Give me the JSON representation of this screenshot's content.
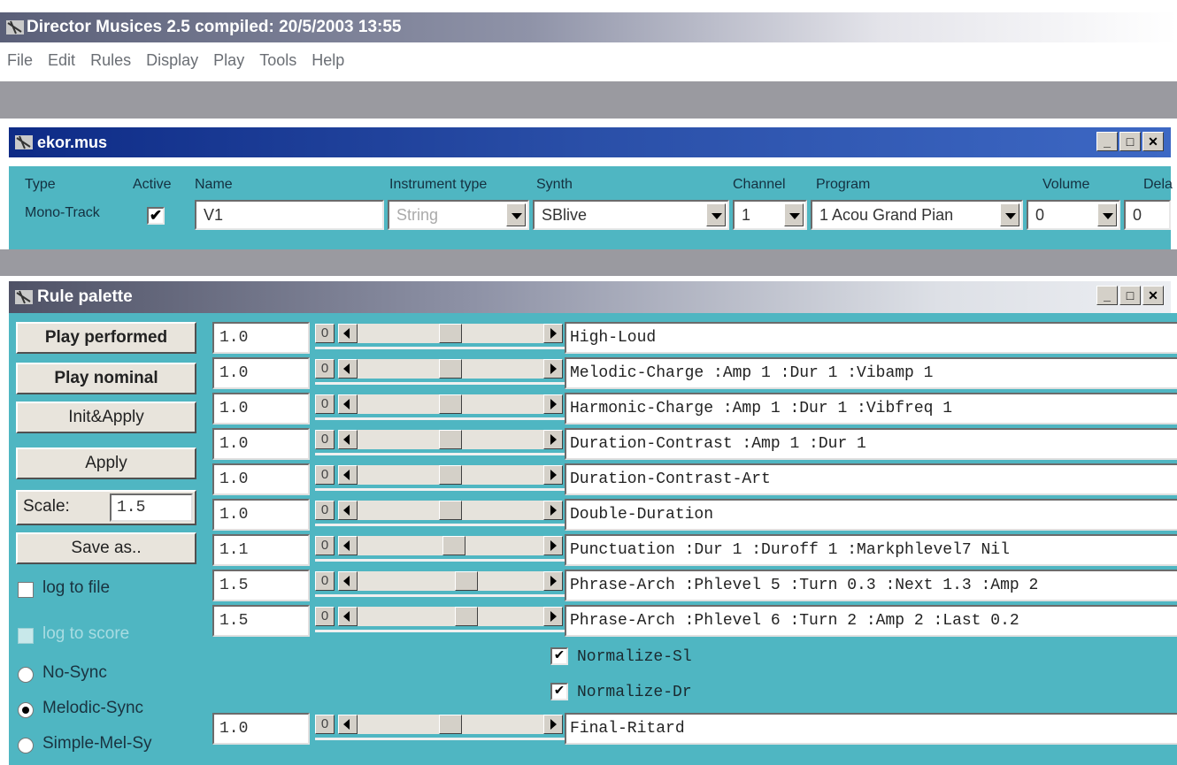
{
  "app": {
    "title": "Director Musices 2.5   compiled: 20/5/2003 13:55",
    "menu": [
      "File",
      "Edit",
      "Rules",
      "Display",
      "Play",
      "Tools",
      "Help"
    ]
  },
  "track_window": {
    "title": "ekor.mus",
    "headers": {
      "type": "Type",
      "active": "Active",
      "name": "Name",
      "instrument_type": "Instrument type",
      "synth": "Synth",
      "channel": "Channel",
      "program": "Program",
      "volume": "Volume",
      "delay": "Dela"
    },
    "row": {
      "type": "Mono-Track",
      "active_mark": "✔",
      "name": "V1",
      "instrument_type": "String",
      "synth": "SBlive",
      "channel": "1",
      "program": "1 Acou Grand Pian",
      "volume": "0",
      "delay": "0"
    }
  },
  "palette": {
    "title": "Rule palette",
    "buttons": {
      "play_performed": "Play performed",
      "play_nominal": "Play nominal",
      "init_apply": "Init&Apply",
      "apply": "Apply",
      "scale_label": "Scale:",
      "scale_value": "1.5",
      "save_as": "Save as.."
    },
    "options": {
      "log_to_file": "log to file",
      "log_to_score": "log to score",
      "no_sync": "No-Sync",
      "melodic_sync": "Melodic-Sync",
      "simple_mel_sync": "Simple-Mel-Sy"
    },
    "rules": [
      {
        "value": "1.0",
        "zero": "0",
        "slider": 0.5,
        "name": "High-Loud"
      },
      {
        "value": "1.0",
        "zero": "0",
        "slider": 0.5,
        "name": "Melodic-Charge :Amp 1 :Dur 1 :Vibamp 1"
      },
      {
        "value": "1.0",
        "zero": "0",
        "slider": 0.5,
        "name": "Harmonic-Charge :Amp 1 :Dur 1 :Vibfreq 1"
      },
      {
        "value": "1.0",
        "zero": "0",
        "slider": 0.5,
        "name": "Duration-Contrast :Amp 1 :Dur 1"
      },
      {
        "value": "1.0",
        "zero": "0",
        "slider": 0.5,
        "name": "Duration-Contrast-Art"
      },
      {
        "value": "1.0",
        "zero": "0",
        "slider": 0.5,
        "name": "Double-Duration"
      },
      {
        "value": "1.1",
        "zero": "0",
        "slider": 0.52,
        "name": "Punctuation :Dur 1 :Duroff 1 :Markphlevel7 Nil"
      },
      {
        "value": "1.5",
        "zero": "0",
        "slider": 0.6,
        "name": "Phrase-Arch :Phlevel 5 :Turn 0.3 :Next 1.3 :Amp 2"
      },
      {
        "value": "1.5",
        "zero": "0",
        "slider": 0.6,
        "name": "Phrase-Arch :Phlevel 6 :Turn 2 :Amp 2 :Last 0.2"
      }
    ],
    "normalize": [
      {
        "mark": "✔",
        "name": "Normalize-Sl"
      },
      {
        "mark": "✔",
        "name": "Normalize-Dr"
      }
    ],
    "final_rule": {
      "value": "1.0",
      "zero": "0",
      "slider": 0.5,
      "name": "Final-Ritard"
    }
  },
  "window_buttons": {
    "minimize": "_",
    "maximize": "□",
    "close": "✕"
  }
}
